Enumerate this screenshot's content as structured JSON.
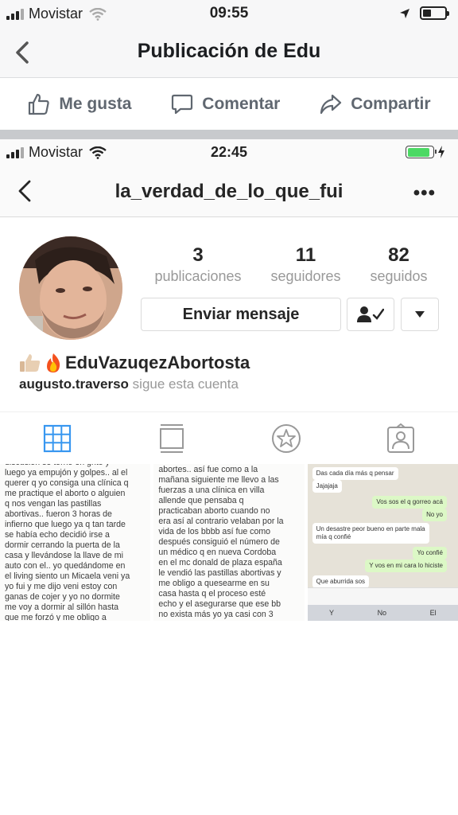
{
  "status_bar": {
    "carrier": "Movistar",
    "time": "09:55"
  },
  "nav": {
    "title": "Publicación de Edu"
  },
  "actions": {
    "like": "Me gusta",
    "comment": "Comentar",
    "share": "Compartir"
  },
  "embedded": {
    "status_bar": {
      "carrier": "Movistar",
      "time": "22:45"
    },
    "header": {
      "username": "la_verdad_de_lo_que_fui",
      "more": "•••"
    },
    "stats": [
      {
        "value": "3",
        "label": "publicaciones"
      },
      {
        "value": "11",
        "label": "seguidores"
      },
      {
        "value": "82",
        "label": "seguidos"
      }
    ],
    "buttons": {
      "send_message": "Enviar mensaje"
    },
    "profile_name": "EduVazuqezAbortosta",
    "followed_by_user": "augusto.traverso",
    "followed_by_suffix": " sigue esta cuenta",
    "posts": {
      "post1_text": "discusión se tornó en grito y\nluego ya empujón y golpes.. al el\nquerer q yo consiga una clínica q\nme practique el aborto o alguien\nq nos vengan las pastillas\nabortivas.. fueron 3 horas de\ninfierno que luego ya q tan tarde\nse había echo decidió irse a\ndormir cerrando la puerta de la\ncasa y llevándose la llave de mi\nauto con el.. yo quedándome en\nel living siento un Micaela veni ya\nyo fui y me dijo veni estoy con\nganas de cojer y yo no dormite\nme voy a dormir al sillón hasta\nque me forzó y me obligo a",
      "post2_text": "abortes.. así fue como a la\nmañana siguiente me llevo a las\nfuerzas a una clínica en villa\nallende que pensaba q\npracticaban aborto cuando no\nera así al contrario velaban por la\nvida de los bbbb así fue como\ndespués consiguió  el número de\nun médico q en nueva Cordoba\nen el mc donald de plaza españa\nle vendió las pastillas abortivas y\nme obligo a quesearme en su\ncasa hasta q el proceso esté\necho y el asegurarse que ese bb\nno exista más yo ya casi con 3",
      "chat": [
        {
          "dir": "in",
          "text": "Das cada día más q pensar"
        },
        {
          "dir": "in",
          "text": "Jajajaja"
        },
        {
          "dir": "out",
          "text": "Vos sos el q gorreo acá"
        },
        {
          "dir": "out",
          "text": "No yo"
        },
        {
          "dir": "in",
          "text": "Un desastre peor bueno en parte mala\nmía q confié"
        },
        {
          "dir": "out",
          "text": "Yo confié"
        },
        {
          "dir": "out",
          "text": "Y vos en mi cara lo hiciste"
        },
        {
          "dir": "in",
          "text": "Que aburrida sos"
        }
      ],
      "keyboard": [
        "Y",
        "No",
        "El"
      ]
    }
  }
}
